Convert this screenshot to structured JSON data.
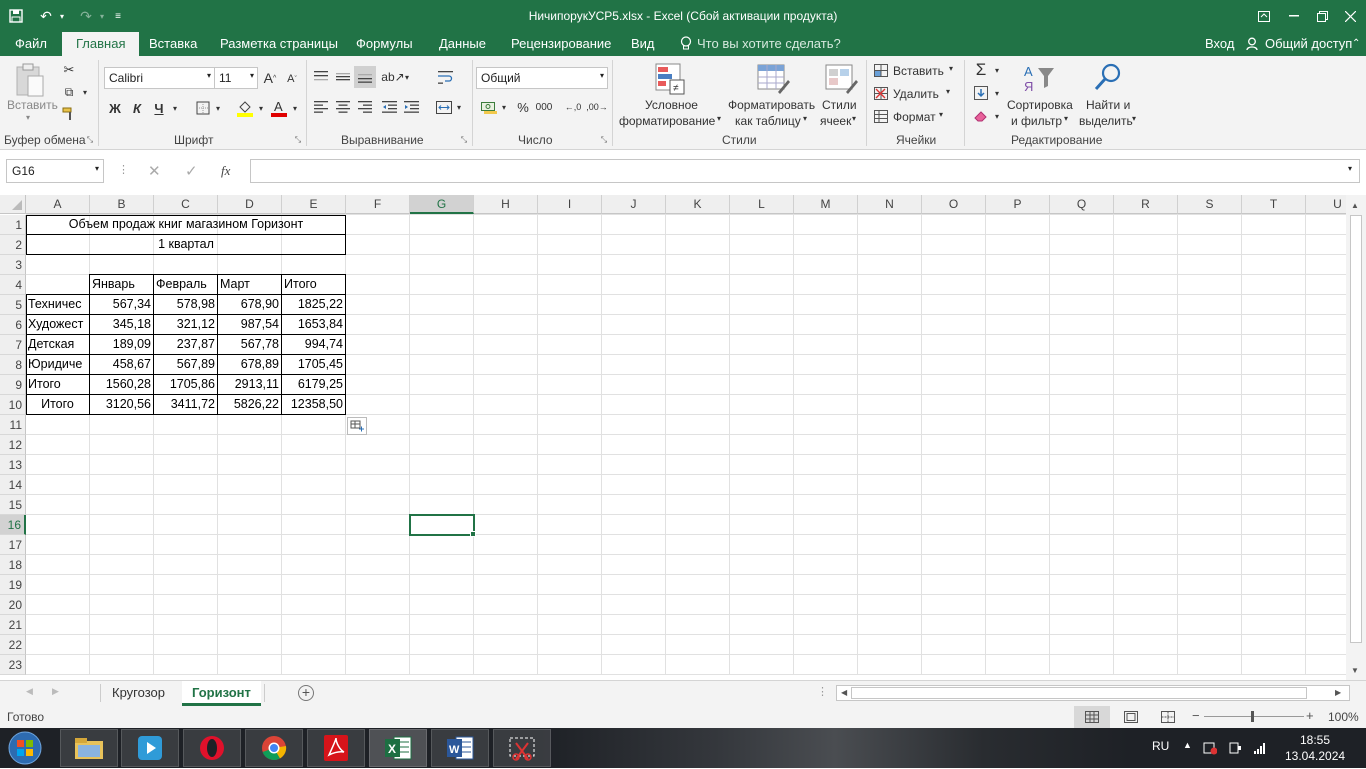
{
  "window": {
    "title": "НичипорукУСР5.xlsx - Excel (Сбой активации продукта)"
  },
  "menu": {
    "tabs": [
      "Файл",
      "Главная",
      "Вставка",
      "Разметка страницы",
      "Формулы",
      "Данные",
      "Рецензирование",
      "Вид"
    ],
    "active": "Главная",
    "tell_me": "Что вы хотите сделать?",
    "login": "Вход",
    "share": "Общий доступ"
  },
  "ribbon": {
    "clipboard": {
      "paste": "Вставить",
      "label": "Буфер обмена"
    },
    "font": {
      "name": "Calibri",
      "size": "11",
      "bold": "Ж",
      "italic": "К",
      "underline": "Ч",
      "label": "Шрифт"
    },
    "alignment": {
      "label": "Выравнивание"
    },
    "number": {
      "format": "Общий",
      "percent": "%",
      "thousands": "000",
      "label": "Число"
    },
    "styles": {
      "conditional_1": "Условное",
      "conditional_2": "форматирование",
      "as_table_1": "Форматировать",
      "as_table_2": "как таблицу",
      "cell_styles_1": "Стили",
      "cell_styles_2": "ячеек",
      "label": "Стили"
    },
    "cells": {
      "insert": "Вставить",
      "delete": "Удалить",
      "format": "Формат",
      "label": "Ячейки"
    },
    "editing": {
      "sort_1": "Сортировка",
      "sort_2": "и фильтр",
      "find_1": "Найти и",
      "find_2": "выделить",
      "label": "Редактирование"
    }
  },
  "formula_bar": {
    "name_box": "G16",
    "fx": "fx",
    "content": ""
  },
  "grid": {
    "columns": [
      "A",
      "B",
      "C",
      "D",
      "E",
      "F",
      "G",
      "H",
      "I",
      "J",
      "K",
      "L",
      "M",
      "N",
      "O",
      "P",
      "Q",
      "R",
      "S",
      "T",
      "U"
    ],
    "rows": [
      "1",
      "2",
      "3",
      "4",
      "5",
      "6",
      "7",
      "8",
      "9",
      "10",
      "11",
      "12",
      "13",
      "14",
      "15",
      "16",
      "17",
      "18",
      "19",
      "20",
      "21",
      "22",
      "23"
    ],
    "selected_cell": "G16",
    "title_cell": "Объем продаж книг магазином Горизонт",
    "subtitle_cell": "1 квартал",
    "header": [
      "Январь",
      "Февраль",
      "Март",
      "Итого"
    ],
    "data_rows": [
      {
        "label": "Техничес",
        "values": [
          "567,34",
          "578,98",
          "678,90",
          "1825,22"
        ]
      },
      {
        "label": "Художест",
        "values": [
          "345,18",
          "321,12",
          "987,54",
          "1653,84"
        ]
      },
      {
        "label": "Детская",
        "values": [
          "189,09",
          "237,87",
          "567,78",
          "994,74"
        ]
      },
      {
        "label": "Юридиче",
        "values": [
          "458,67",
          "567,89",
          "678,89",
          "1705,45"
        ]
      },
      {
        "label": "Итого",
        "values": [
          "1560,28",
          "1705,86",
          "2913,11",
          "6179,25"
        ]
      },
      {
        "label": "Итого",
        "values": [
          "3120,56",
          "3411,72",
          "5826,22",
          "12358,50"
        ]
      }
    ]
  },
  "sheets": {
    "tabs": [
      "Кругозор",
      "Горизонт"
    ],
    "active": "Горизонт"
  },
  "status": {
    "ready": "Готово",
    "zoom": "100%"
  },
  "taskbar": {
    "lang": "RU",
    "time": "18:55",
    "date": "13.04.2024"
  }
}
